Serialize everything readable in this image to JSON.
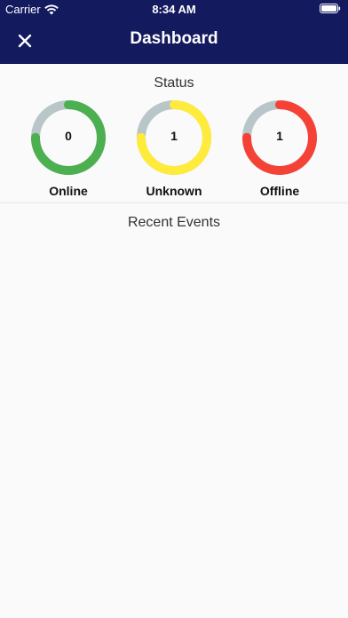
{
  "status_bar": {
    "carrier": "Carrier",
    "time": "8:34 AM"
  },
  "header": {
    "title": "Dashboard",
    "background_color": "#131a5e"
  },
  "status_section": {
    "title": "Status",
    "gauges": [
      {
        "label": "Online",
        "value": "0",
        "color": "#4caf50",
        "track_color": "#b8c5c9",
        "fill_fraction": 0.75
      },
      {
        "label": "Unknown",
        "value": "1",
        "color": "#ffeb3b",
        "track_color": "#b8c5c9",
        "fill_fraction": 0.75
      },
      {
        "label": "Offline",
        "value": "1",
        "color": "#f44336",
        "track_color": "#b8c5c9",
        "fill_fraction": 0.75
      }
    ]
  },
  "events_section": {
    "title": "Recent Events"
  },
  "icons": {
    "close": "close-icon",
    "wifi": "wifi-icon",
    "battery": "battery-icon"
  }
}
